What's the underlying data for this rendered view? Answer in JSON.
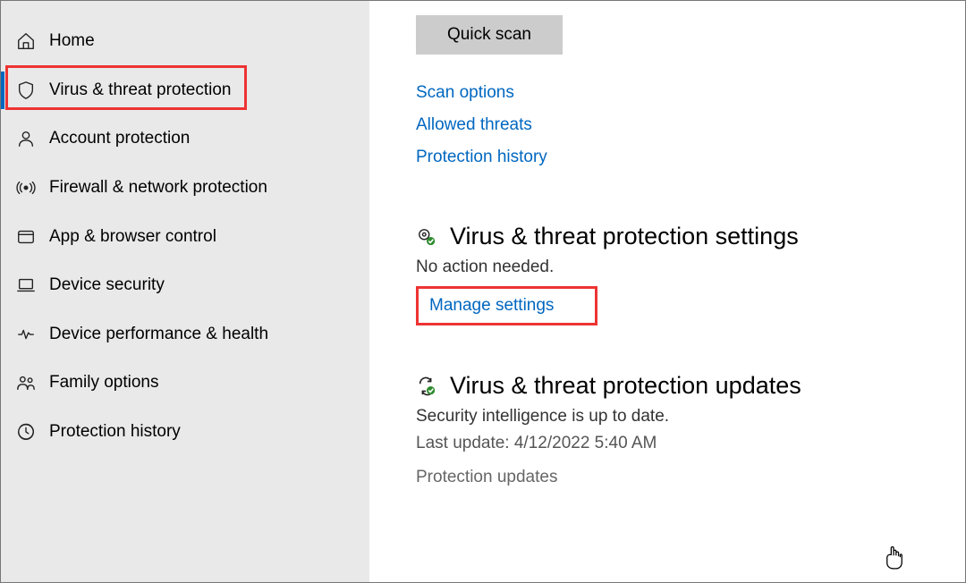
{
  "sidebar": {
    "items": [
      {
        "label": "Home"
      },
      {
        "label": "Virus & threat protection"
      },
      {
        "label": "Account protection"
      },
      {
        "label": "Firewall & network protection"
      },
      {
        "label": "App & browser control"
      },
      {
        "label": "Device security"
      },
      {
        "label": "Device performance & health"
      },
      {
        "label": "Family options"
      },
      {
        "label": "Protection history"
      }
    ],
    "selected_index": 1
  },
  "main": {
    "quick_scan_button": "Quick scan",
    "links": {
      "scan_options": "Scan options",
      "allowed_threats": "Allowed threats",
      "protection_history": "Protection history"
    },
    "settings_section": {
      "title": "Virus & threat protection settings",
      "status": "No action needed.",
      "manage_link": "Manage settings"
    },
    "updates_section": {
      "title": "Virus & threat protection updates",
      "status": "Security intelligence is up to date.",
      "last_update_label": "Last update: 4/12/2022 5:40 AM",
      "updates_link": "Protection updates"
    }
  }
}
